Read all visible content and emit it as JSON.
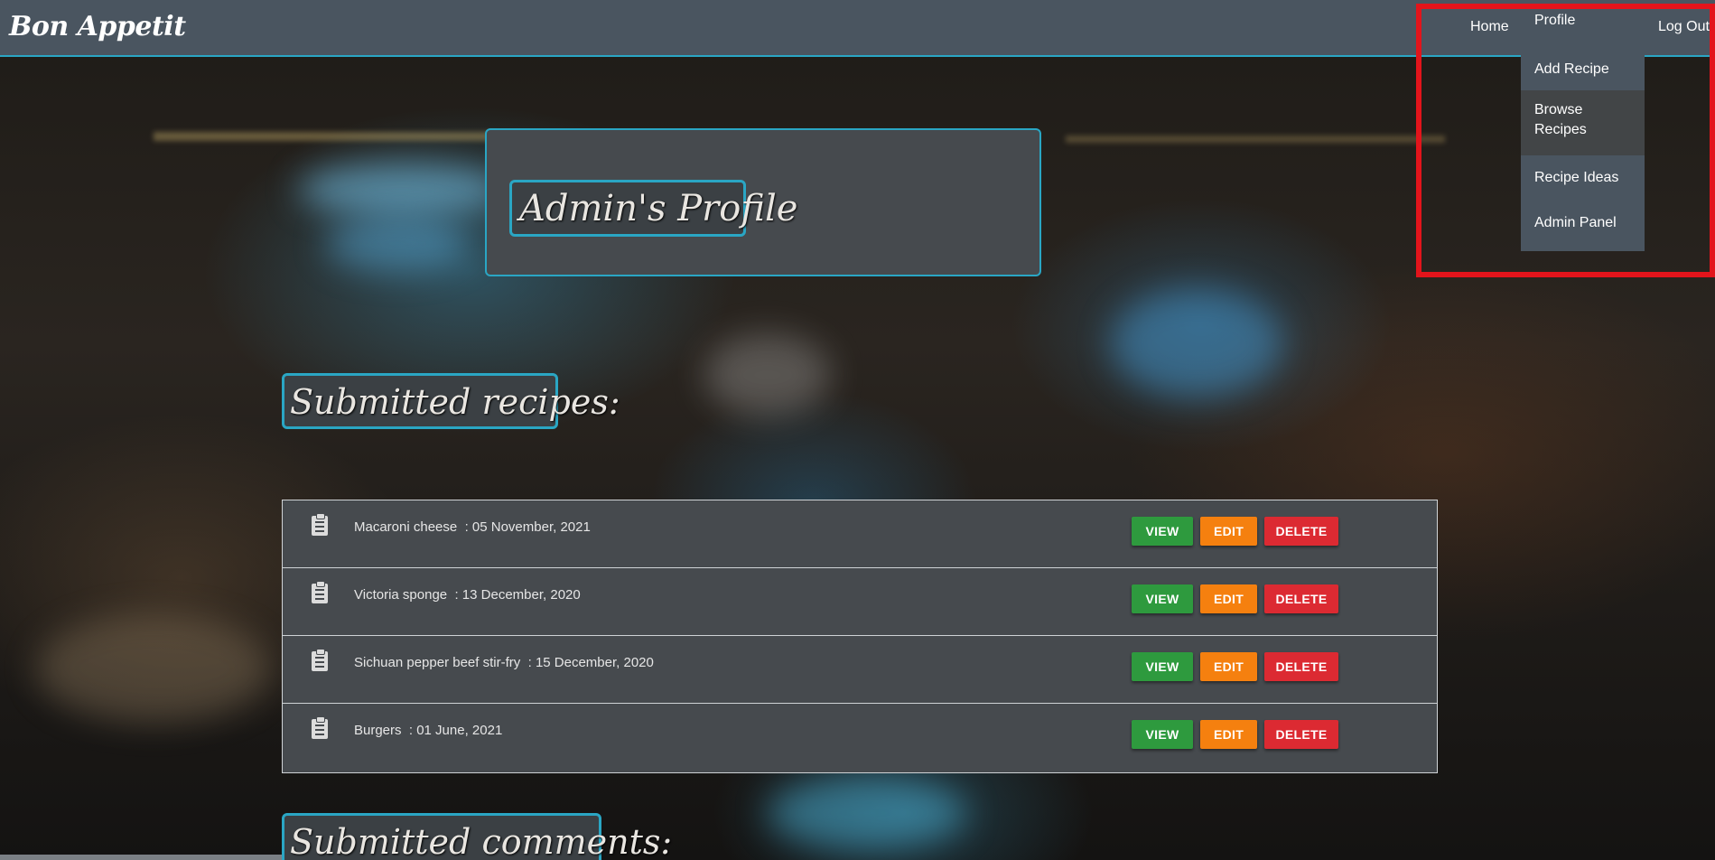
{
  "navbar": {
    "brand": "Bon Appetit",
    "home": "Home",
    "logout": "Log Out",
    "dropdown": {
      "items": [
        "Profile",
        "Add Recipe",
        "Browse Recipes",
        "Recipe Ideas",
        "Admin Panel"
      ]
    }
  },
  "profile": {
    "title": "Admin's Profile"
  },
  "recipes": {
    "heading": "Submitted recipes:",
    "buttons": {
      "view": "VIEW",
      "edit": "EDIT",
      "delete": "DELETE"
    },
    "rows": [
      {
        "name": "Macaroni cheese",
        "date": "05 November, 2021"
      },
      {
        "name": "Victoria sponge",
        "date": "13 December, 2020"
      },
      {
        "name": "Sichuan pepper beef stir-fry",
        "date": "15 December, 2020"
      },
      {
        "name": "Burgers",
        "date": "01 June, 2021"
      }
    ]
  },
  "comments": {
    "heading": "Submitted comments:"
  },
  "colors": {
    "accent": "#2aa6c4",
    "navbar": "#4a5560",
    "view": "#2e9a3e",
    "edit": "#f5800f",
    "delete": "#dc2a32",
    "highlight": "#e3141b"
  }
}
